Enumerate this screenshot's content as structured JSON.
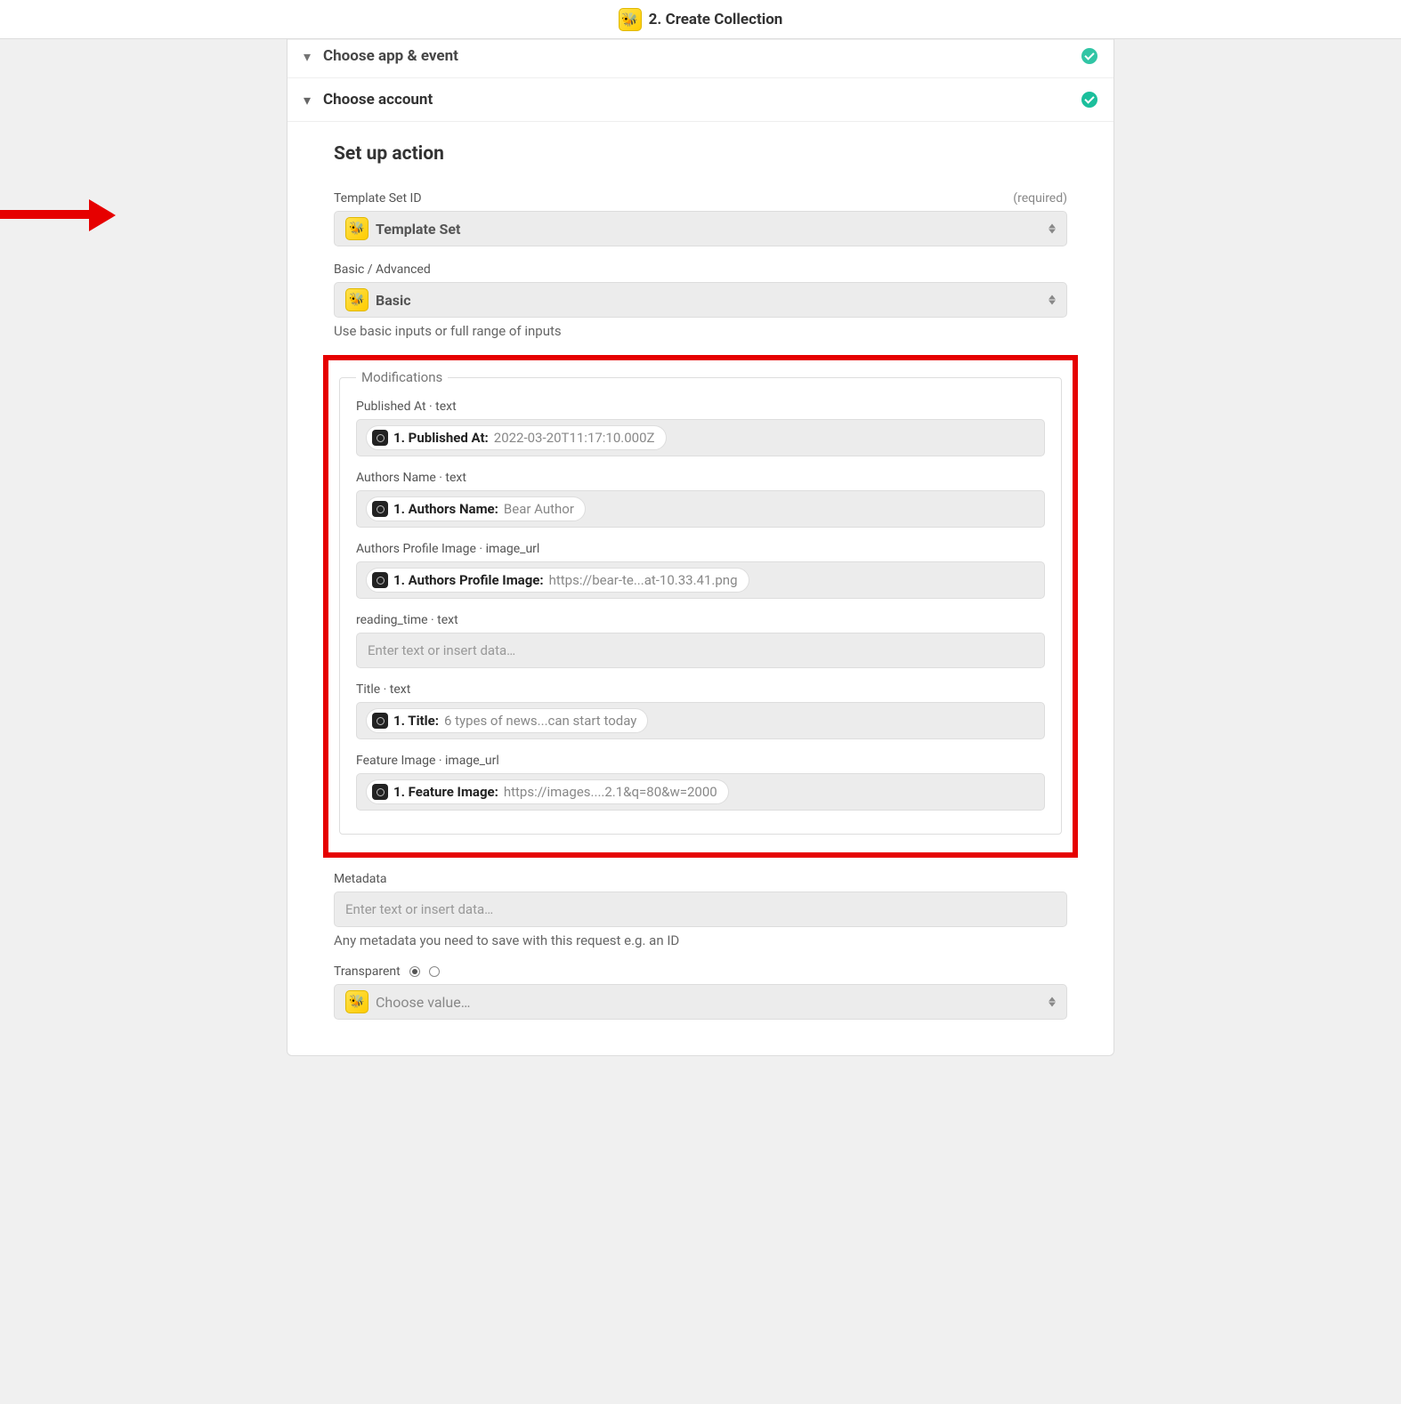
{
  "top": {
    "title": "2. Create Collection"
  },
  "sections": {
    "choose_app": "Choose app & event",
    "choose_account": "Choose account"
  },
  "setup": {
    "heading": "Set up action",
    "template_set": {
      "label": "Template Set ID",
      "required": "(required)",
      "value": "Template Set"
    },
    "basic_advanced": {
      "label": "Basic / Advanced",
      "value": "Basic",
      "helper": "Use basic inputs or full range of inputs"
    },
    "modifications_legend": "Modifications",
    "mods": [
      {
        "label": "Published At · text",
        "chip_prefix": "1. Published At:",
        "chip_value": "2022-03-20T11:17:10.000Z"
      },
      {
        "label": "Authors Name · text",
        "chip_prefix": "1. Authors Name:",
        "chip_value": "Bear Author"
      },
      {
        "label": "Authors Profile Image · image_url",
        "chip_prefix": "1. Authors Profile Image:",
        "chip_value": "https://bear-te...at-10.33.41.png"
      },
      {
        "label": "reading_time · text",
        "placeholder": "Enter text or insert data…"
      },
      {
        "label": "Title · text",
        "chip_prefix": "1. Title:",
        "chip_value": "6 types of news...can start today"
      },
      {
        "label": "Feature Image · image_url",
        "chip_prefix": "1. Feature Image:",
        "chip_value": "https://images....2.1&q=80&w=2000"
      }
    ],
    "metadata": {
      "label": "Metadata",
      "placeholder": "Enter text or insert data…",
      "helper": "Any metadata you need to save with this request e.g. an ID"
    },
    "transparent": {
      "label": "Transparent",
      "placeholder": "Choose value…"
    }
  }
}
